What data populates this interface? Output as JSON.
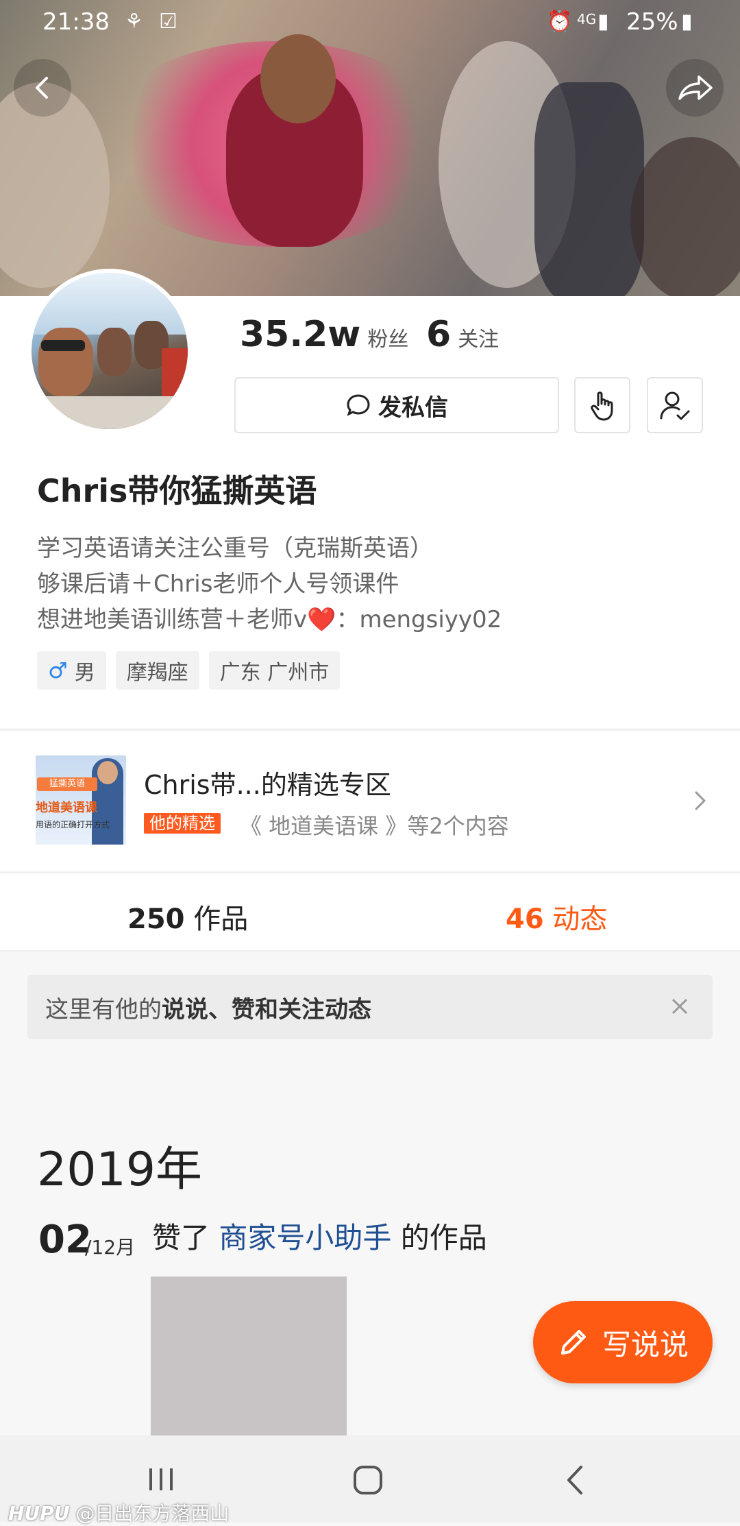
{
  "status_bar": {
    "time": "21:38",
    "battery": "25%",
    "network": "4G"
  },
  "stats": {
    "followers_value": "35.2w",
    "followers_label": "粉丝",
    "following_value": "6",
    "following_label": "关注"
  },
  "actions": {
    "message_label": "发私信"
  },
  "profile": {
    "name": "Chris带你猛撕英语",
    "bio": [
      "学习英语请关注公重号（克瑞斯英语）",
      "够课后请＋Chris老师个人号领课件",
      "想进地美语训练营＋老师v❤️：mengsiyy02"
    ],
    "tags": {
      "gender_symbol": "♂",
      "gender": "男",
      "zodiac": "摩羯座",
      "location": "广东 广州市"
    }
  },
  "featured": {
    "title": "Chris带...的精选专区",
    "badge": "他的精选",
    "subtitle": "《 地道美语课 》等2个内容",
    "thumb_tag": "猛撕英语",
    "thumb_title": "地道美语课",
    "thumb_caption": "用语的正确打开方式"
  },
  "tabs": [
    {
      "count": "250",
      "label": "作品",
      "active": false
    },
    {
      "count": "46",
      "label": "动态",
      "active": true
    }
  ],
  "notice": {
    "prefix": "这里有他的 ",
    "bold": "说说、赞和关注动态"
  },
  "timeline": {
    "year": "2019年",
    "day": "02",
    "month": "/12月",
    "action_prefix": "赞了 ",
    "account": "商家号小助手",
    "action_suffix": " 的作品"
  },
  "fab": {
    "label": "写说说"
  },
  "watermark": {
    "brand": "HUPU",
    "handle": "@日出东方落西山"
  },
  "colors": {
    "accent": "#ff5a14",
    "link": "#1f4f92",
    "male": "#2c87e8"
  }
}
